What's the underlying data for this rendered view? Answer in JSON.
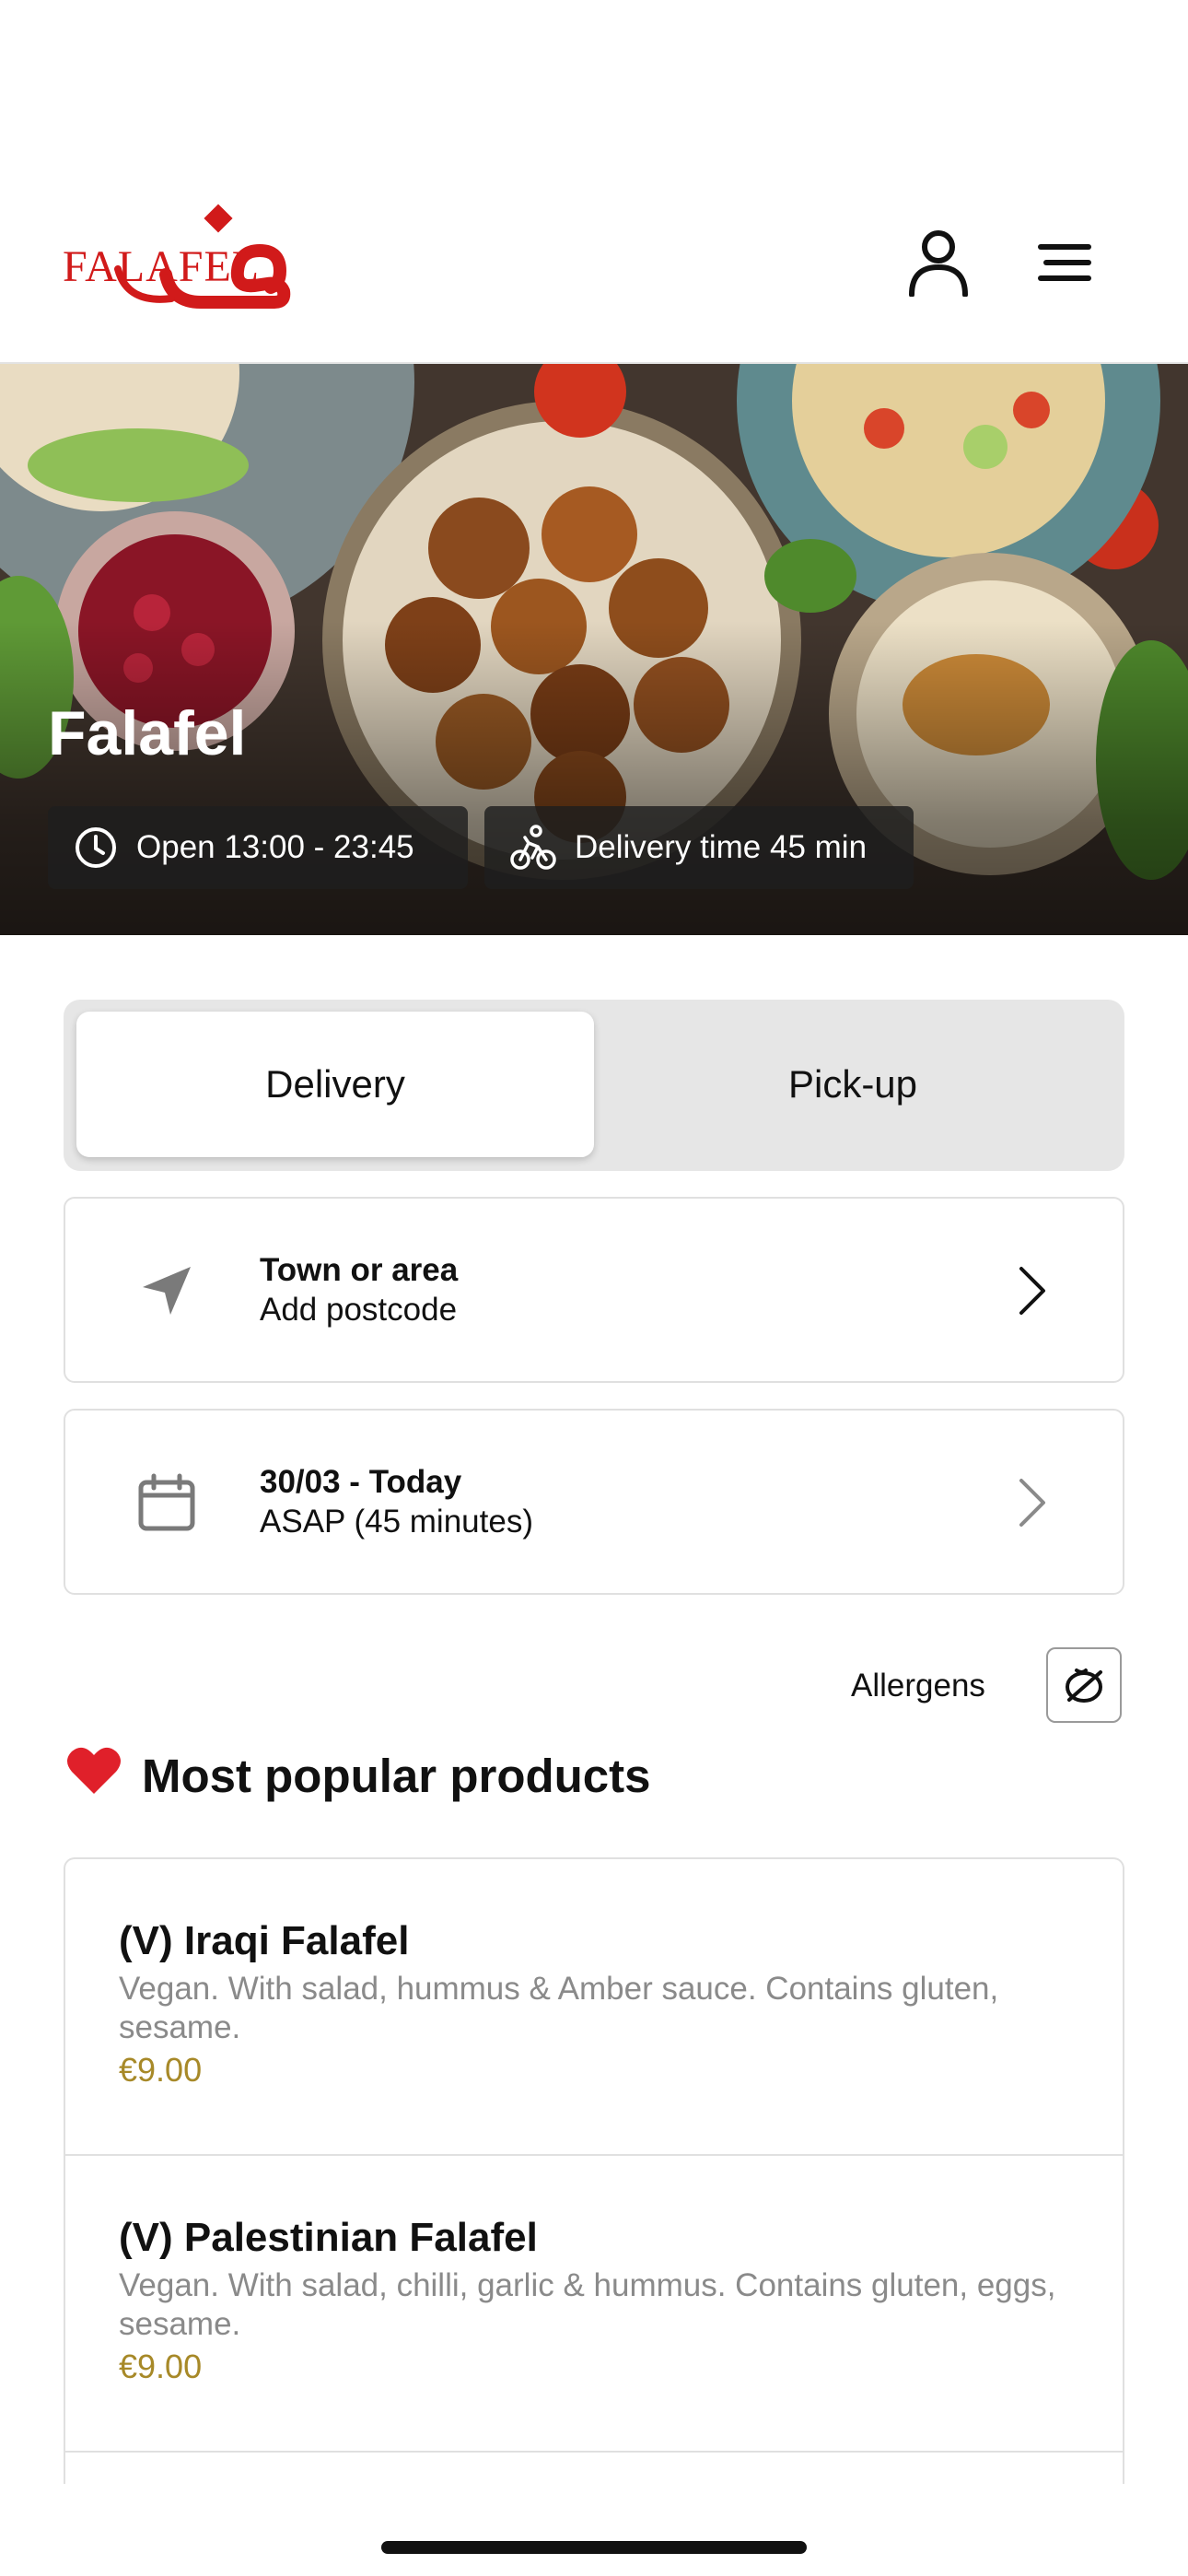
{
  "header": {
    "logo_text": "FALAFEL",
    "logo_color": "#d11a1a",
    "user_icon": "user-icon",
    "menu_icon": "hamburger-menu-icon"
  },
  "hero": {
    "title": "Falafel",
    "open_hours": "Open 13:00 - 23:45",
    "delivery_time": "Delivery time 45 min"
  },
  "order_mode": {
    "options": [
      "Delivery",
      "Pick-up"
    ],
    "selected": "Delivery"
  },
  "location": {
    "title": "Town or area",
    "subtitle": "Add postcode"
  },
  "schedule": {
    "title": "30/03 - Today",
    "subtitle": "ASAP (45 minutes)"
  },
  "allergens": {
    "label": "Allergens"
  },
  "popular": {
    "emoji": "❤️",
    "title": "Most popular products",
    "products": [
      {
        "name": "(V) Iraqi Falafel",
        "description": "Vegan. With salad, hummus & Amber sauce. Contains gluten, sesame.",
        "price": "€9.00"
      },
      {
        "name": "(V) Palestinian Falafel",
        "description": "Vegan. With salad, chilli, garlic & hummus. Contains gluten, eggs, sesame.",
        "price": "€9.00"
      }
    ]
  },
  "colors": {
    "price": "#a78928",
    "brand": "#d11a1a"
  }
}
